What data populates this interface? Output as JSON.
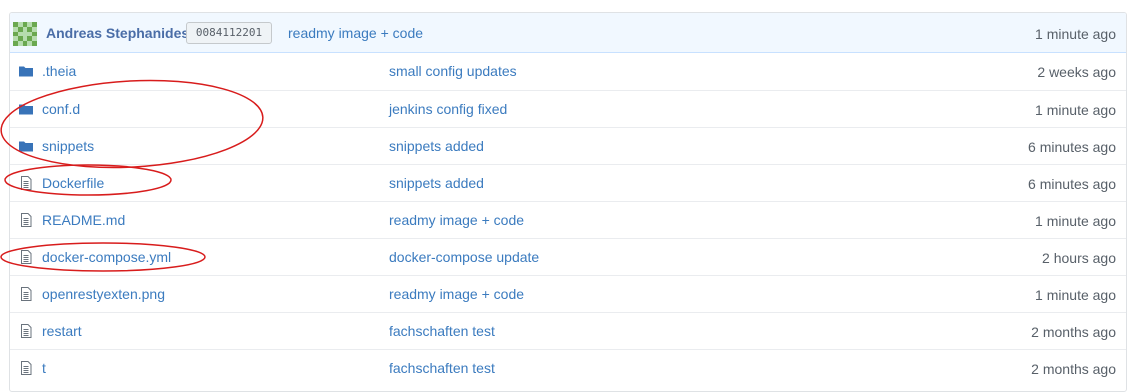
{
  "commit": {
    "author": "Andreas Stephanides",
    "sha": "0084112201",
    "message": "readmy image + code",
    "age": "1 minute ago"
  },
  "files": [
    {
      "type": "folder",
      "icon": "folder-icon",
      "name": ".theia",
      "message": "small config updates",
      "age": "2 weeks ago"
    },
    {
      "type": "folder",
      "icon": "folder-icon",
      "name": "conf.d",
      "message": "jenkins config fixed",
      "age": "1 minute ago"
    },
    {
      "type": "folder",
      "icon": "folder-icon",
      "name": "snippets",
      "message": "snippets added",
      "age": "6 minutes ago"
    },
    {
      "type": "file",
      "icon": "file-icon",
      "name": "Dockerfile",
      "message": "snippets added",
      "age": "6 minutes ago"
    },
    {
      "type": "file",
      "icon": "file-icon",
      "name": "README.md",
      "message": "readmy image + code",
      "age": "1 minute ago"
    },
    {
      "type": "file",
      "icon": "file-icon",
      "name": "docker-compose.yml",
      "message": "docker-compose update",
      "age": "2 hours ago"
    },
    {
      "type": "file",
      "icon": "file-icon",
      "name": "openrestyexten.png",
      "message": "readmy image + code",
      "age": "1 minute ago"
    },
    {
      "type": "file",
      "icon": "file-icon",
      "name": "restart",
      "message": "fachschaften test",
      "age": "2 months ago"
    },
    {
      "type": "file",
      "icon": "file-icon",
      "name": "t",
      "message": "fachschaften test",
      "age": "2 months ago"
    }
  ],
  "colors": {
    "link": "#3b7bbf",
    "folder": "#3873b8",
    "file": "#6a737d",
    "annotation": "#d81c1c",
    "header_bg": "#f1f8ff"
  }
}
